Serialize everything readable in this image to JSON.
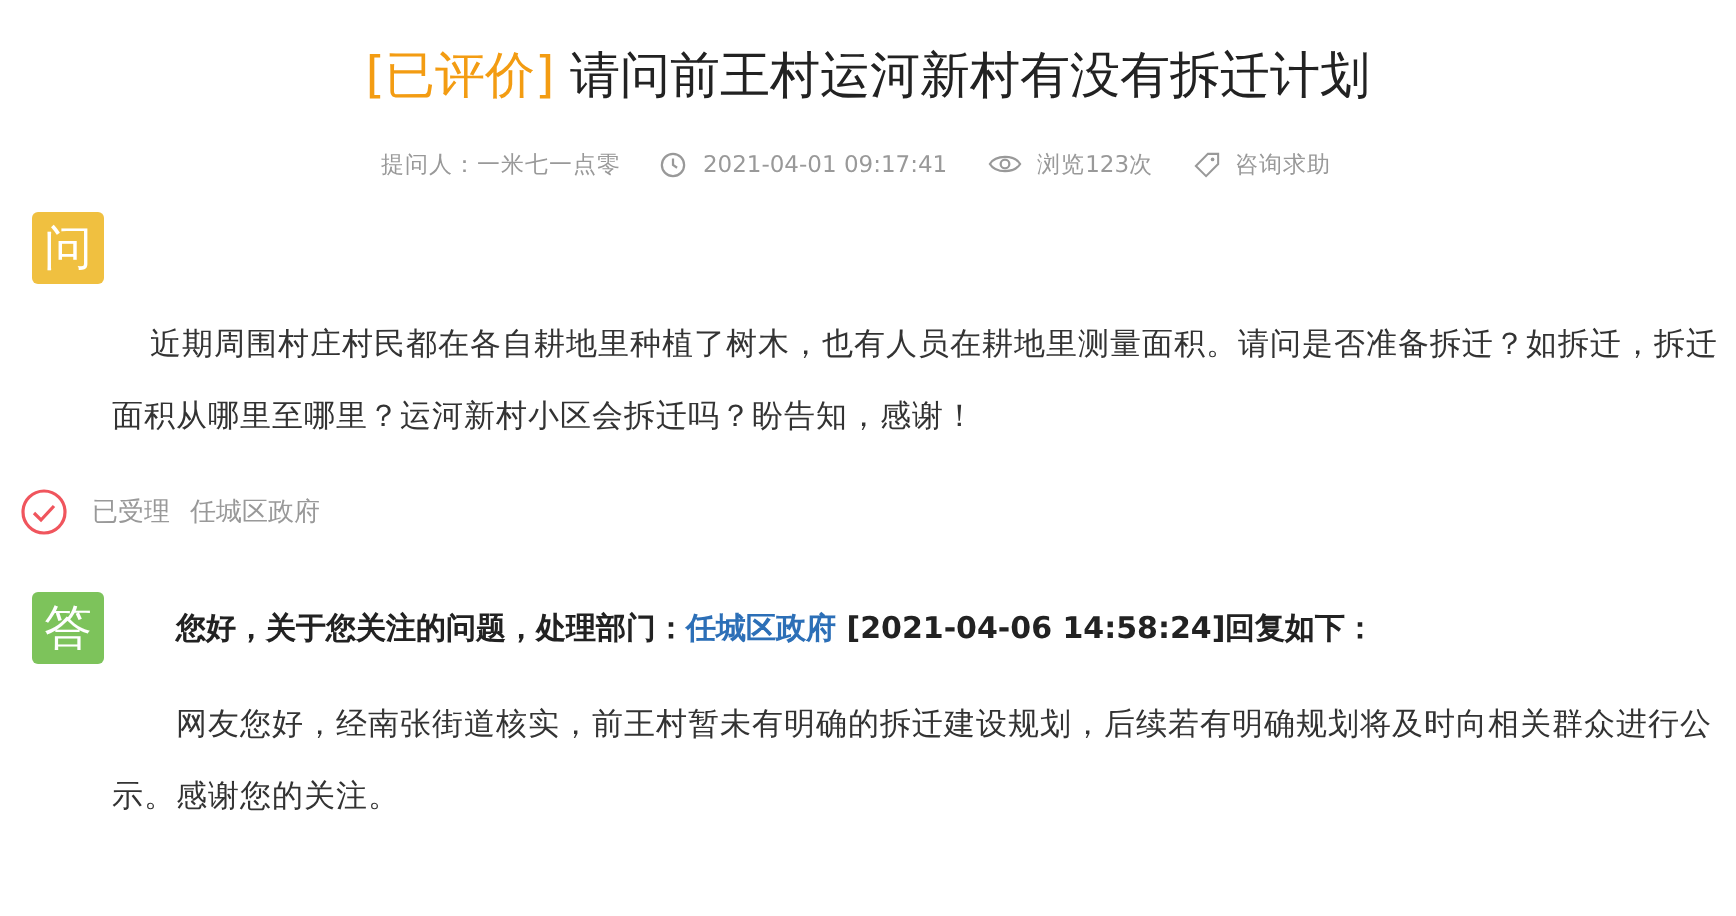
{
  "title": {
    "status_tag": "[已评价]",
    "text": "请问前王村运河新村有没有拆迁计划"
  },
  "meta": {
    "asker": "提问人：一米七一点零",
    "time": "2021-04-01 09:17:41",
    "views": "浏览123次",
    "category": "咨询求助"
  },
  "question": {
    "badge": "问",
    "text": "近期周围村庄村民都在各自耕地里种植了树木，也有人员在耕地里测量面积。请问是否准备拆迁？如拆迁，拆迁面积从哪里至哪里？运河新村小区会拆迁吗？盼告知，感谢！"
  },
  "status": {
    "label": "已受理",
    "department": "任城区政府"
  },
  "answer": {
    "badge": "答",
    "intro_prefix": "您好，关于您关注的问题，处理部门：",
    "department": "任城区政府",
    "intro_suffix": "[2021-04-06 14:58:24]回复如下：",
    "text": "网友您好，经南张街道核实，前王村暂未有明确的拆迁建设规划，后续若有明确规划将及时向相关群众进行公示。感谢您的关注。"
  }
}
